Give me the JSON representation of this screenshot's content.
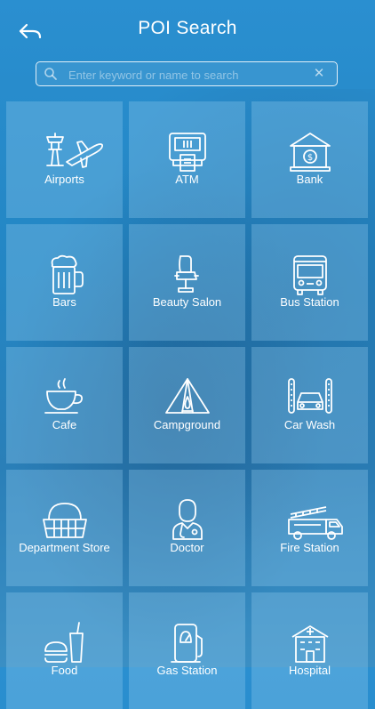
{
  "header": {
    "title": "POI Search",
    "back_icon": "back-arrow-icon"
  },
  "search": {
    "placeholder": "Enter keyword or name to search",
    "value": "",
    "clear_glyph": "✕"
  },
  "categories": [
    {
      "label": "Airports",
      "icon": "airport-icon"
    },
    {
      "label": "ATM",
      "icon": "atm-icon"
    },
    {
      "label": "Bank",
      "icon": "bank-icon"
    },
    {
      "label": "Bars",
      "icon": "beer-mug-icon"
    },
    {
      "label": "Beauty Salon",
      "icon": "salon-chair-icon"
    },
    {
      "label": "Bus Station",
      "icon": "bus-icon"
    },
    {
      "label": "Cafe",
      "icon": "coffee-cup-icon"
    },
    {
      "label": "Campground",
      "icon": "tent-icon"
    },
    {
      "label": "Car Wash",
      "icon": "car-wash-icon"
    },
    {
      "label": "Department Store",
      "icon": "basket-icon"
    },
    {
      "label": "Doctor",
      "icon": "doctor-icon"
    },
    {
      "label": "Fire Station",
      "icon": "fire-truck-icon"
    },
    {
      "label": "Food",
      "icon": "fast-food-icon"
    },
    {
      "label": "Gas Station",
      "icon": "gas-pump-icon"
    },
    {
      "label": "Hospital",
      "icon": "hospital-icon"
    }
  ],
  "colors": {
    "background": "#2386c4",
    "tile": "#96cdf0",
    "text": "#ffffff"
  }
}
